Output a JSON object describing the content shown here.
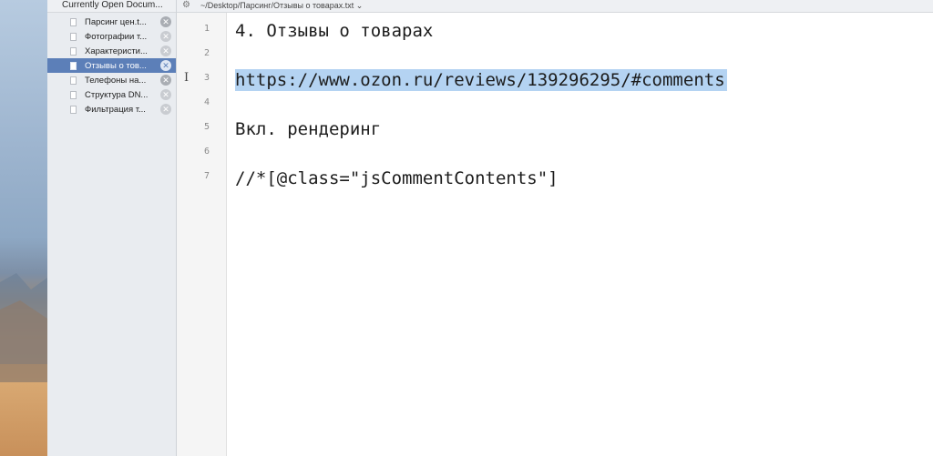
{
  "sidebar": {
    "header": "Currently Open Docum...",
    "documents": [
      {
        "label": "Парсинг цен.t..."
      },
      {
        "label": "Фотографии т..."
      },
      {
        "label": "Характеристи..."
      },
      {
        "label": "Отзывы о тов..."
      },
      {
        "label": "Телефоны на..."
      },
      {
        "label": "Структура DN..."
      },
      {
        "label": "Фильтрация т..."
      }
    ],
    "selected_index": 3
  },
  "pathbar": {
    "gear_icon": "⚙",
    "path": "~/Desktop/Парсинг/Отзывы о товарах.txt ⌄"
  },
  "editor": {
    "line_numbers": [
      "1",
      "2",
      "3",
      "4",
      "5",
      "6",
      "7"
    ],
    "lines": [
      "4. Отзывы о товарах",
      "",
      "https://www.ozon.ru/reviews/139296295/#comments",
      "",
      "Вкл. рендеринг",
      "",
      "//*[@class=\"jsCommentContents\"]"
    ],
    "highlighted_line_index": 2
  },
  "colors": {
    "selection_highlight": "#b4d3f2",
    "sidebar_selected": "#5c7fb8"
  }
}
